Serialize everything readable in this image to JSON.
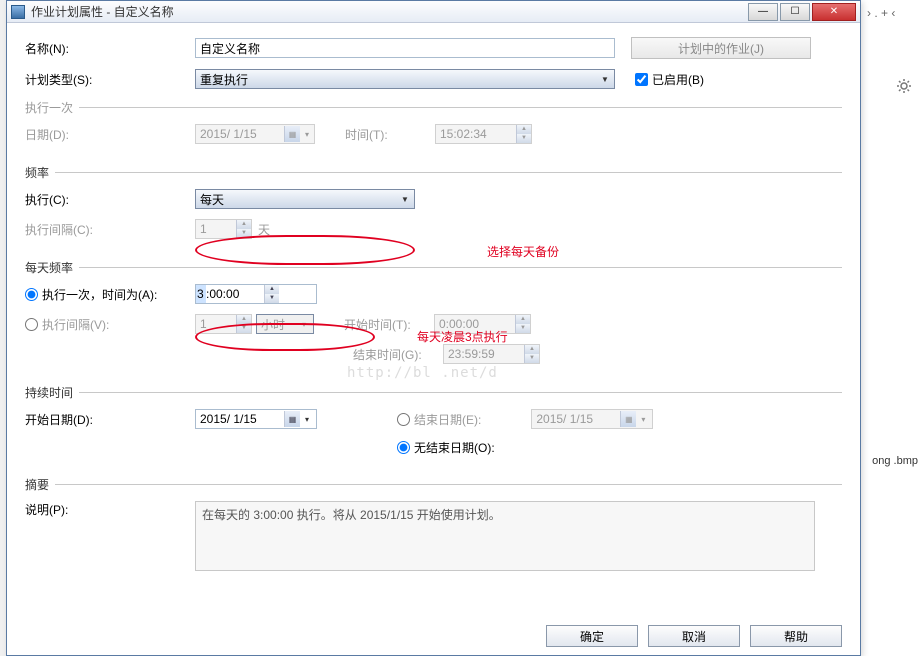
{
  "titlebar": {
    "title": "作业计划属性 - 自定义名称"
  },
  "name": {
    "label": "名称(N):",
    "value": "自定义名称",
    "jobs_button": "计划中的作业(J)"
  },
  "schedule_type": {
    "label": "计划类型(S):",
    "value": "重复执行",
    "enabled_label": "已启用(B)"
  },
  "once": {
    "legend": "执行一次",
    "date_label": "日期(D):",
    "date_value": "2015/ 1/15",
    "time_label": "时间(T):",
    "time_value": "15:02:34"
  },
  "freq": {
    "legend": "频率",
    "exec_label": "执行(C):",
    "exec_value": "每天",
    "interval_label": "执行间隔(C):",
    "interval_value": "1",
    "interval_unit": "天"
  },
  "daily": {
    "legend": "每天频率",
    "once_label": "执行一次，时间为(A):",
    "once_value": "3:00:00",
    "interval_label": "执行间隔(V):",
    "interval_value": "1",
    "interval_unit": "小时",
    "start_label": "开始时间(T):",
    "start_value": "0:00:00",
    "end_label": "结束时间(G):",
    "end_value": "23:59:59"
  },
  "duration": {
    "legend": "持续时间",
    "start_date_label": "开始日期(D):",
    "start_date_value": "2015/ 1/15",
    "end_date_label": "结束日期(E):",
    "end_date_value": "2015/ 1/15",
    "no_end_label": "无结束日期(O):"
  },
  "summary": {
    "legend": "摘要",
    "desc_label": "说明(P):",
    "desc_value": "在每天的 3:00:00 执行。将从 2015/1/15 开始使用计划。"
  },
  "annotations": {
    "select_daily": "选择每天备份",
    "exec_3am": "每天凌晨3点执行"
  },
  "footer": {
    "ok": "确定",
    "cancel": "取消",
    "help": "帮助"
  },
  "background": {
    "file": "ong .bmp",
    "toolbar": "› . + ‹"
  },
  "watermark": "http://bl            .net/d"
}
